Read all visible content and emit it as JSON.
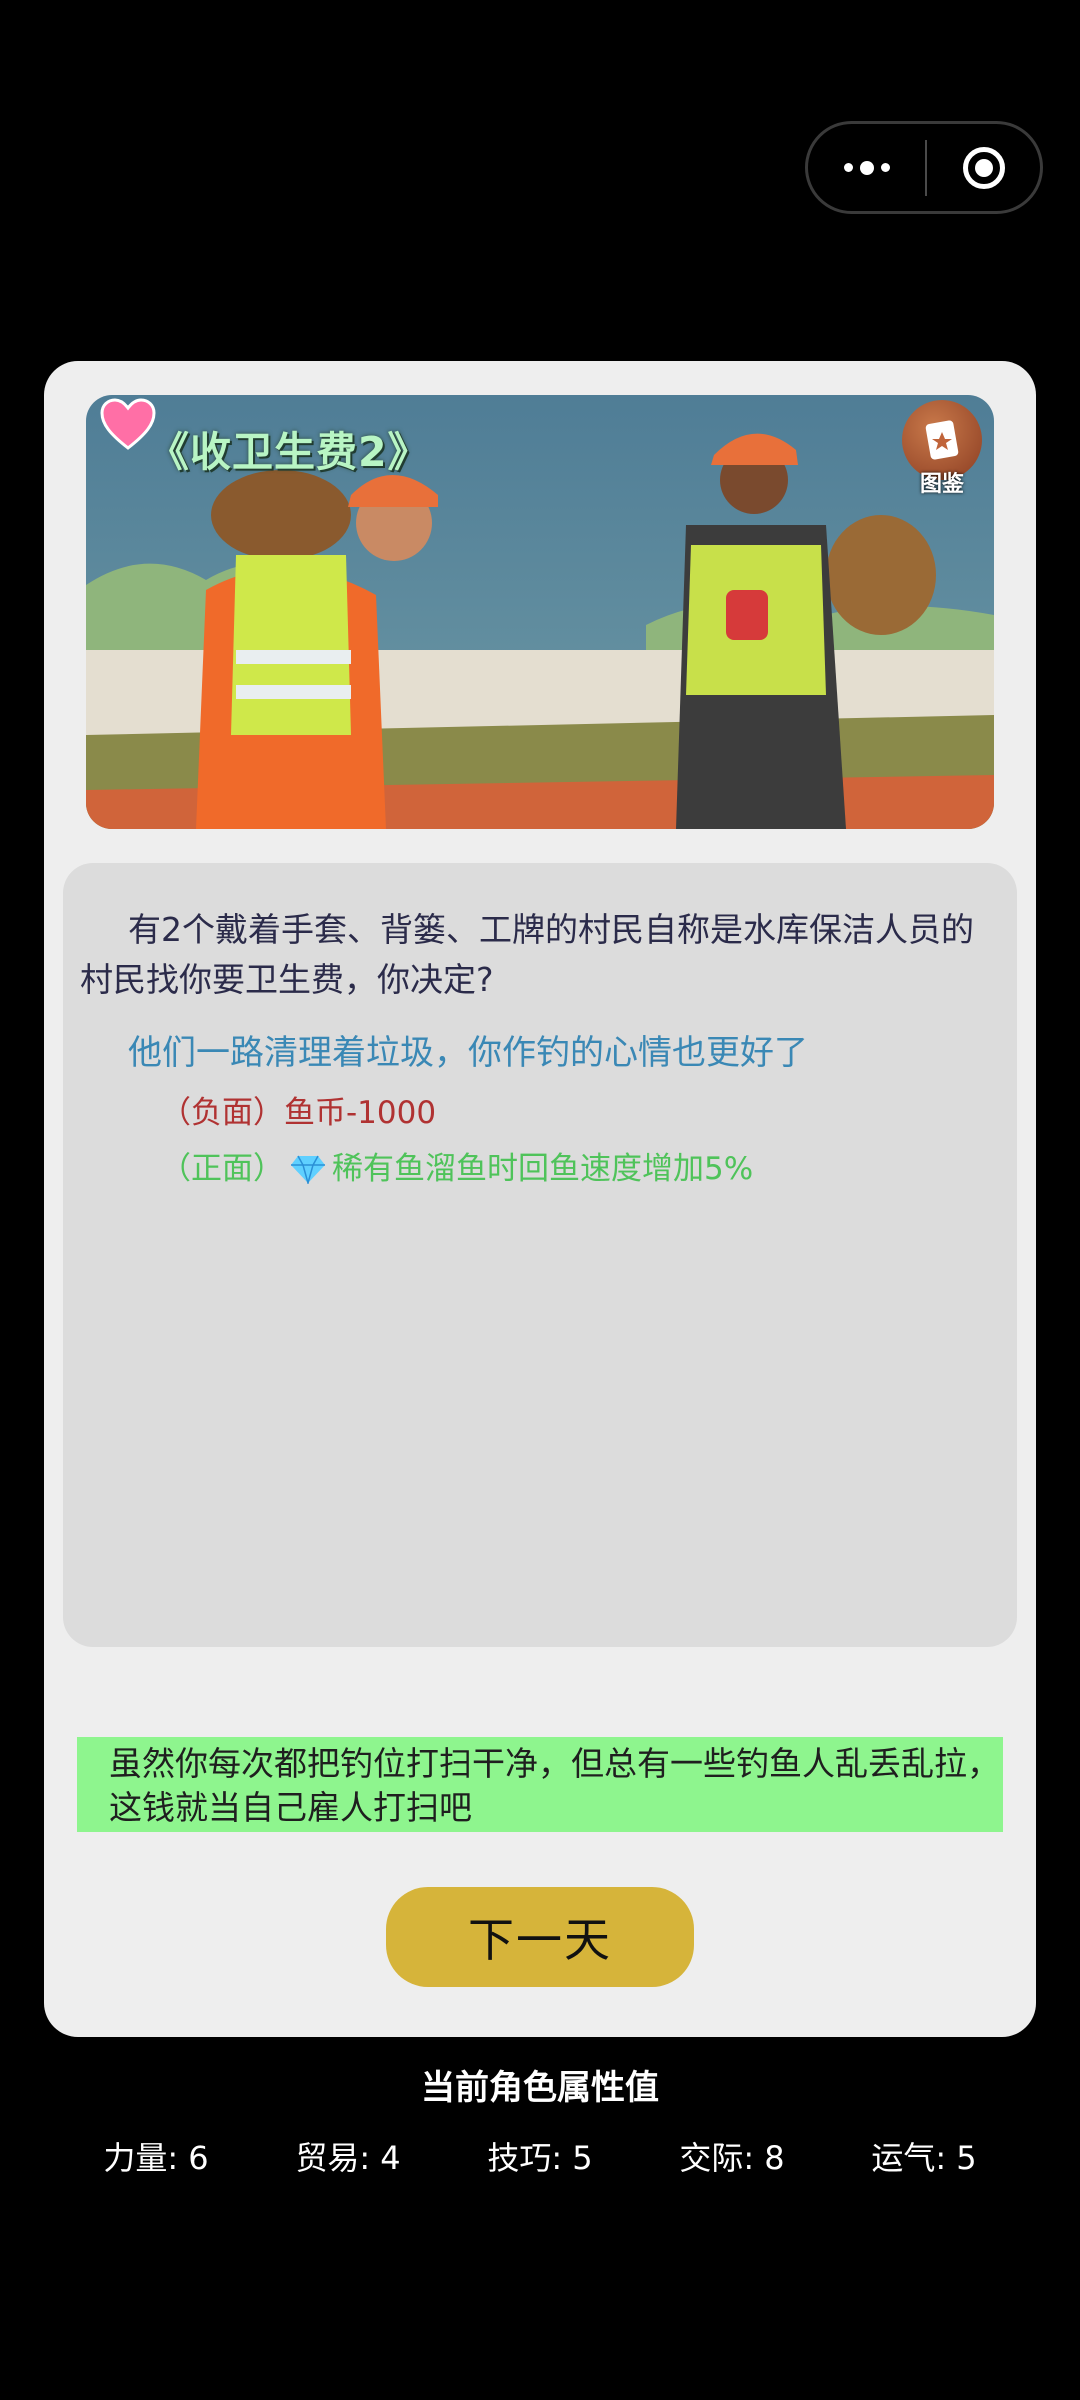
{
  "capsule": {
    "more_icon": "ellipsis-icon",
    "close_icon": "target-circle-icon"
  },
  "event": {
    "title": "《收卫生费2》",
    "album_label": "图鉴",
    "question": "有2个戴着手套、背篓、工牌的村民自称是水库保洁人员的村民找你要卫生费，你决定?",
    "result": "他们一路清理着垃圾，你作钓的心情也更好了",
    "negative": {
      "tag": "（负面）",
      "text": "鱼币-1000"
    },
    "positive": {
      "tag": "（正面）",
      "icon": "gem-icon",
      "text": "稀有鱼溜鱼时回鱼速度增加5%"
    },
    "choice_text": "虽然你每次都把钓位打扫干净，但总有一些钓鱼人乱丢乱拉，这钱就当自己雇人打扫吧"
  },
  "next_button": "下一天",
  "attributes": {
    "title": "当前角色属性值",
    "items": [
      {
        "label": "力量: 6"
      },
      {
        "label": "贸易: 4"
      },
      {
        "label": "技巧: 5"
      },
      {
        "label": "交际: 8"
      },
      {
        "label": "运气: 5"
      }
    ]
  },
  "colors": {
    "background": "#000000",
    "card": "#eeeeee",
    "panel": "#dcdcdc",
    "result": "#3a88b5",
    "negative": "#b03232",
    "positive": "#4fc35a",
    "choice_bg": "#8ef58e",
    "button": "#d6b43a"
  }
}
